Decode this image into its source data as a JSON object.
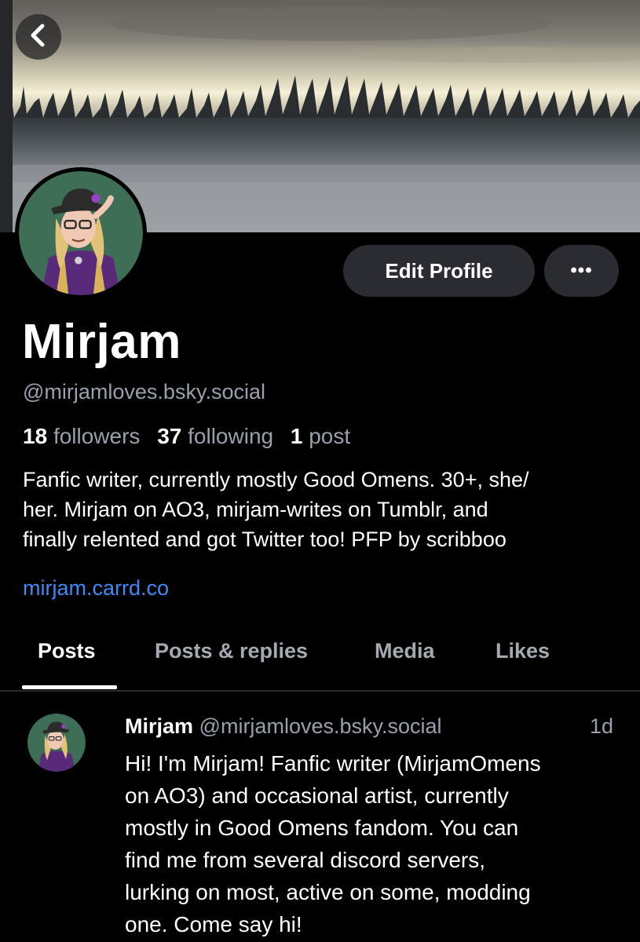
{
  "header": {
    "back_icon": "chevron-left-icon",
    "banner_description": "misty forest banner"
  },
  "profile": {
    "display_name": "Mirjam",
    "handle": "@mirjamloves.bsky.social",
    "edit_label": "Edit Profile",
    "more_label": "•••",
    "stats": {
      "followers_count": "18",
      "followers_label": "followers",
      "following_count": "37",
      "following_label": "following",
      "posts_count": "1",
      "posts_label": "post"
    },
    "bio_lines": [
      "Fanfic writer, currently mostly Good Omens. 30+, she/",
      "her. Mirjam on AO3, mirjam-writes on Tumblr, and",
      "finally relented and got Twitter too! PFP by scribboo"
    ],
    "link": "mirjam.carrd.co"
  },
  "tabs": [
    {
      "label": "Posts",
      "active": true
    },
    {
      "label": "Posts & replies",
      "active": false
    },
    {
      "label": "Media",
      "active": false
    },
    {
      "label": "Likes",
      "active": false
    }
  ],
  "post": {
    "author": "Mirjam",
    "handle": "@mirjamloves.bsky.social",
    "time": "1d",
    "body_lines": [
      "Hi! I'm Mirjam! Fanfic writer (MirjamOmens",
      "on AO3) and occasional artist, currently",
      "mostly in Good Omens fandom. You can",
      "find me from several discord servers,",
      "lurking on most, active on some, modding",
      "one. Come say hi!"
    ]
  },
  "colors": {
    "background": "#000000",
    "button_bg": "#2b2c31",
    "muted_text": "#9aa0ab",
    "link": "#3f8af6"
  }
}
